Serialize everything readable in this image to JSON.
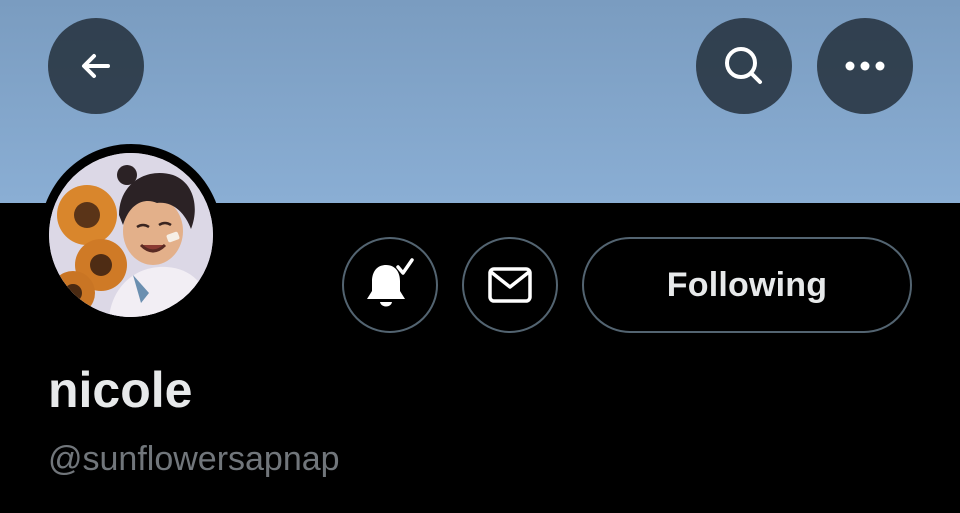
{
  "header": {
    "back_icon": "arrow-left-icon",
    "search_icon": "search-icon",
    "more_icon": "more-horizontal-icon",
    "banner_color": "#86a8cf"
  },
  "profile": {
    "display_name": "nicole",
    "handle": "@sunflowersapnap",
    "avatar_icon": "avatar-image"
  },
  "actions": {
    "notifications_icon": "bell-check-icon",
    "message_icon": "envelope-icon",
    "following_label": "Following"
  },
  "colors": {
    "background": "#000000",
    "primary_text": "#e7e9ea",
    "secondary_text": "#71767b",
    "border": "#536471"
  }
}
